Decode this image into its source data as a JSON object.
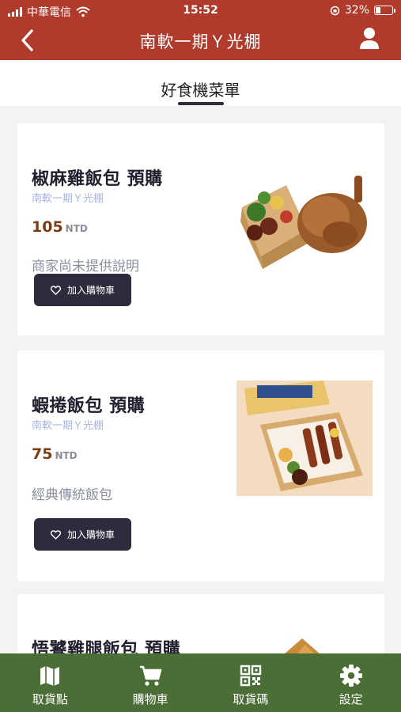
{
  "status": {
    "carrier": "中華電信",
    "time": "15:52",
    "battery": "32%",
    "battery_level": 0.32
  },
  "header": {
    "title": "南軟一期Ｙ光棚"
  },
  "tabs": [
    {
      "label": "好食機菜單",
      "active": true
    }
  ],
  "menu": [
    {
      "name": "椒麻雞飯包 預購",
      "location": "南軟一期Ｙ光棚",
      "price": "105",
      "currency": "NTD",
      "description": "商家尚未提供說明",
      "cart_label": "加入購物車"
    },
    {
      "name": "蝦捲飯包 預購",
      "location": "南軟一期Ｙ光棚",
      "price": "75",
      "currency": "NTD",
      "description": "經典傳統飯包",
      "cart_label": "加入購物車"
    },
    {
      "name": "悟饕雞腿飯包 預購"
    }
  ],
  "bottom_nav": [
    {
      "label": "取貨點",
      "icon": "map-icon"
    },
    {
      "label": "購物車",
      "icon": "cart-icon"
    },
    {
      "label": "取貨碼",
      "icon": "qr-code-icon"
    },
    {
      "label": "設定",
      "icon": "gear-icon"
    }
  ],
  "colors": {
    "header": "#b03a2b",
    "bottom_nav": "#4a6e35",
    "button": "#2c2c3d",
    "price": "#7a3e12",
    "location": "#a9b4e4"
  }
}
